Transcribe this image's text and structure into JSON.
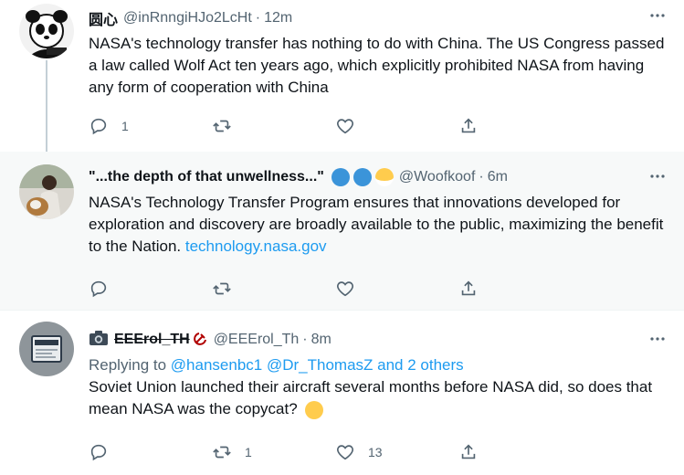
{
  "tweets": [
    {
      "name": "圆心",
      "handle": "@inRnngiHJo2LcHt",
      "time": "12m",
      "text": "NASA's technology transfer has nothing to do with China. The US Congress passed a law called Wolf Act ten years ago, which explicitly prohibited NASA from having any form of cooperation with China",
      "reply_count": "1",
      "retweet_count": "",
      "like_count": ""
    },
    {
      "name": "\"...the depth of that unwellness...\"",
      "handle": "@Woofkoof",
      "time": "6m",
      "text": "NASA's Technology Transfer Program ensures that innovations developed for exploration and discovery are broadly available to the public, maximizing the benefit to the Nation.",
      "link": "technology.nasa.gov",
      "reply_count": "",
      "retweet_count": "",
      "like_count": ""
    },
    {
      "name": "EEErol_TH",
      "handle": "@EEErol_Th",
      "time": "8m",
      "replying_prefix": "Replying to",
      "replying_users": "@hansenbc1 @Dr_ThomasZ and 2 others",
      "text": "Soviet Union launched their aircraft several months before NASA did, so does that mean NASA was the copycat?",
      "reply_count": "",
      "retweet_count": "1",
      "like_count": "13"
    }
  ],
  "separator": "·",
  "colors": {
    "text": "#0f1419",
    "secondary": "#536471",
    "link": "#1d9bf0",
    "highlight_bg": "#f7f9f9"
  }
}
